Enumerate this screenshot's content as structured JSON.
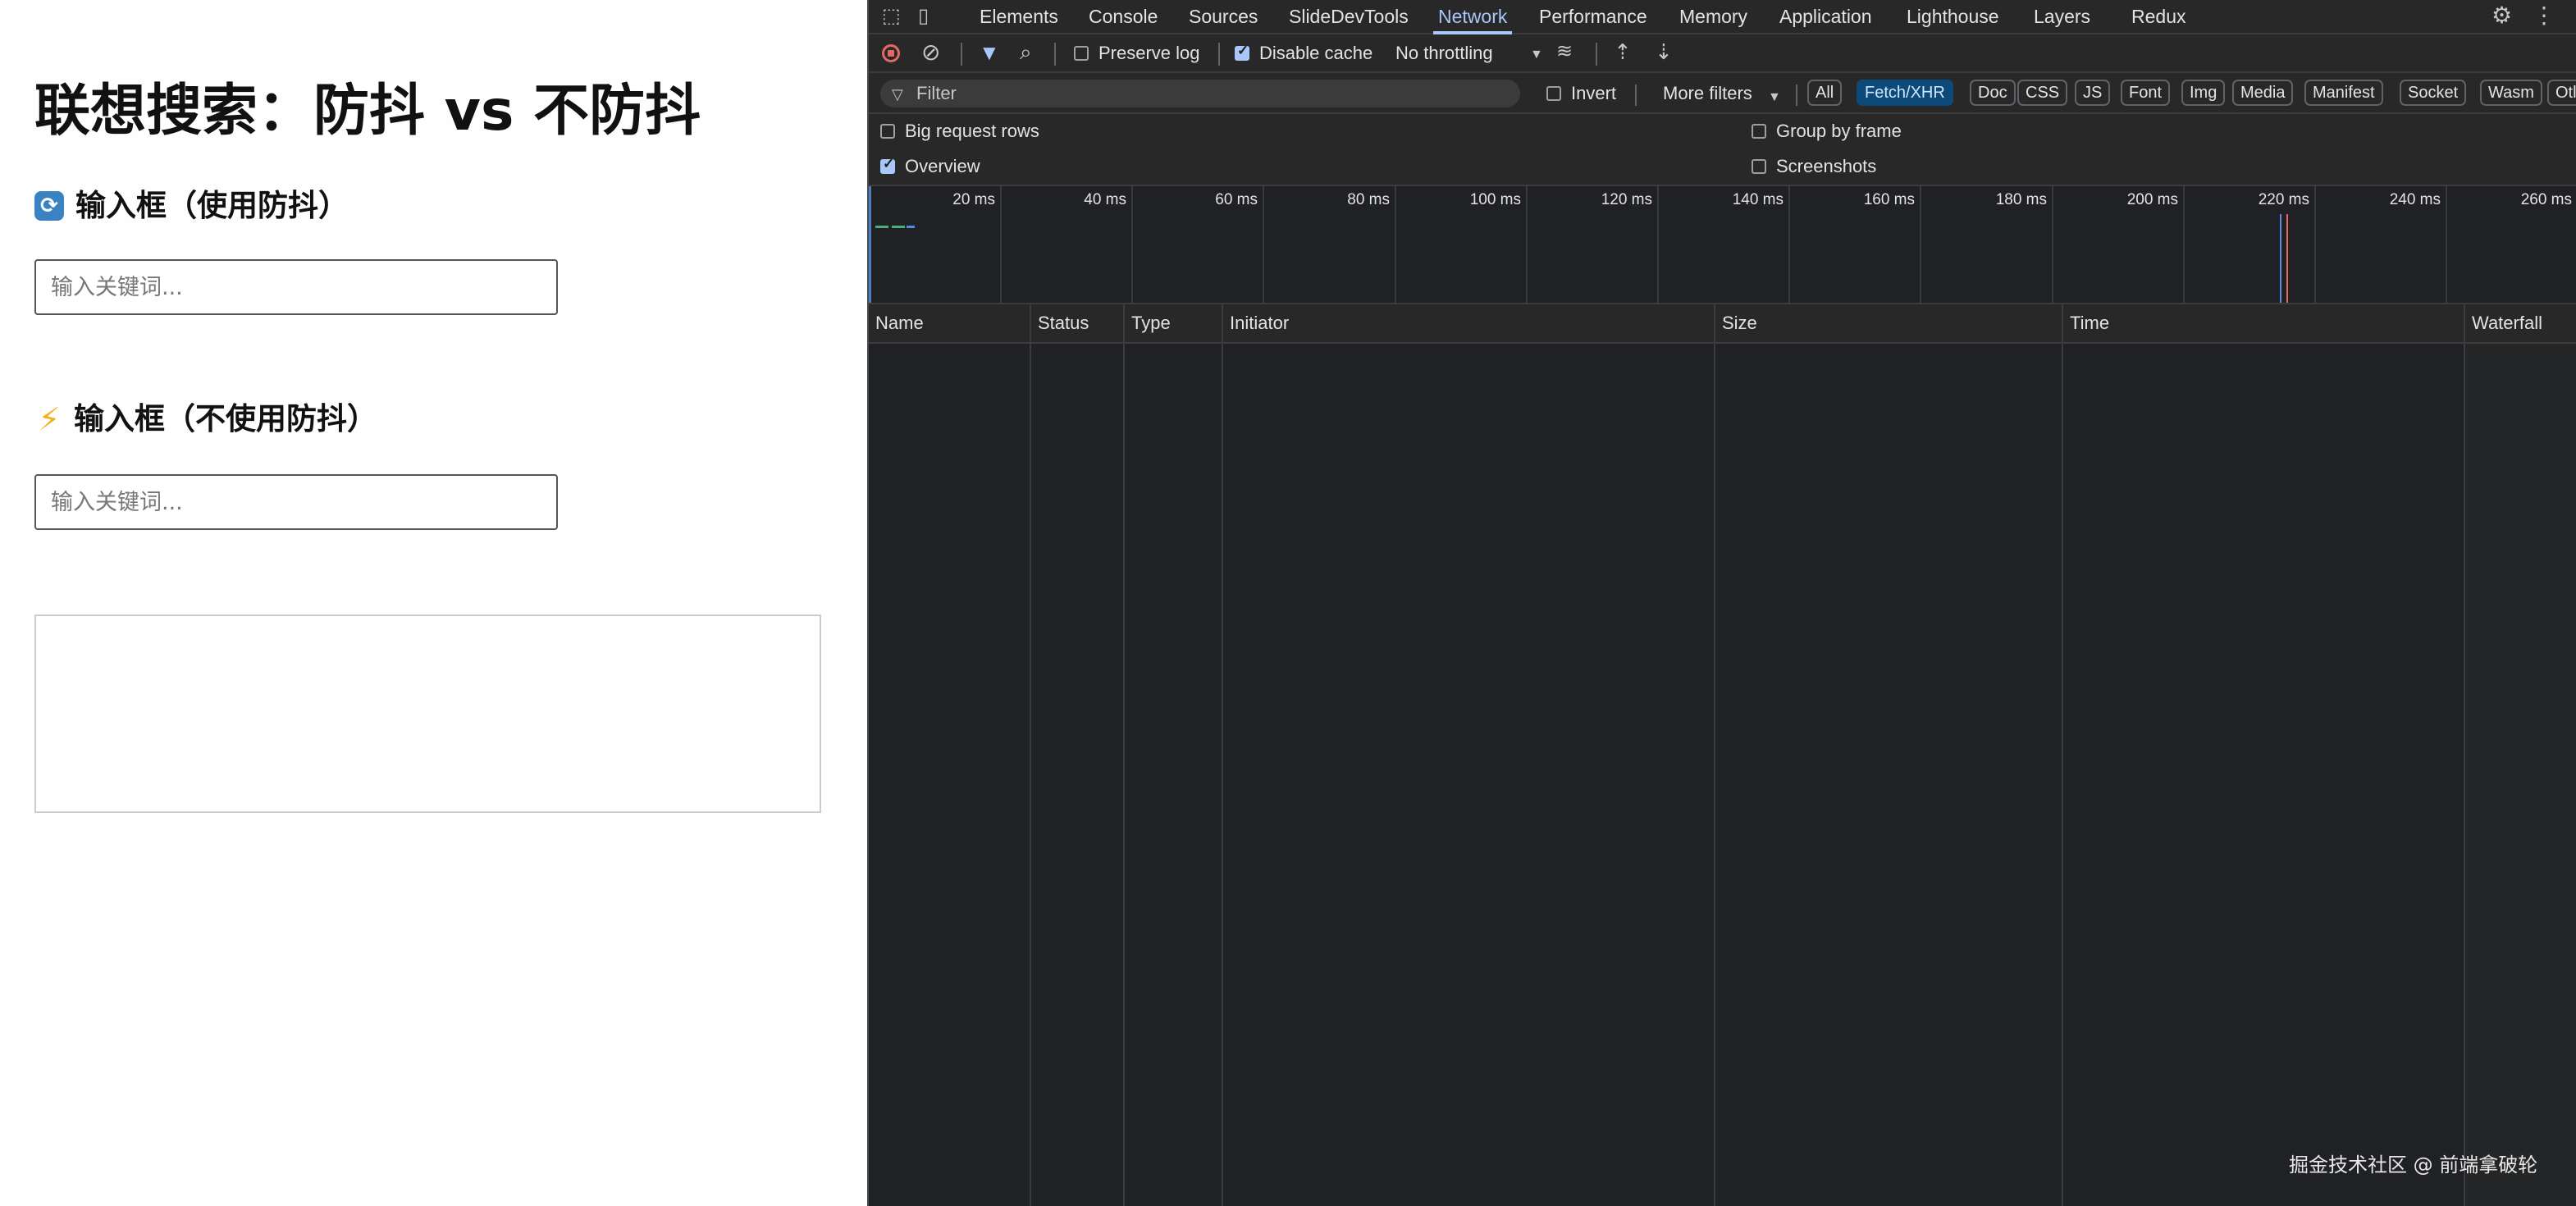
{
  "page": {
    "title": "联想搜索：防抖 vs 不防抖",
    "debounce_section": {
      "icon": "refresh-emoji",
      "heading": "输入框（使用防抖）",
      "placeholder": "输入关键词..."
    },
    "no_debounce_section": {
      "icon": "lightning-emoji",
      "heading": "输入框（不使用防抖）",
      "placeholder": "输入关键词..."
    }
  },
  "devtools": {
    "tabs": [
      {
        "label": "Elements"
      },
      {
        "label": "Console"
      },
      {
        "label": "Sources"
      },
      {
        "label": "SlideDevTools"
      },
      {
        "label": "Network"
      },
      {
        "label": "Performance"
      },
      {
        "label": "Memory"
      },
      {
        "label": "Application"
      },
      {
        "label": "Lighthouse"
      },
      {
        "label": "Layers"
      },
      {
        "label": "Redux"
      }
    ],
    "active_tab": "Network",
    "toolbar": {
      "preserve_log": {
        "label": "Preserve log",
        "checked": false
      },
      "disable_cache": {
        "label": "Disable cache",
        "checked": true
      },
      "throttling": "No throttling"
    },
    "filter": {
      "placeholder": "Filter",
      "invert": {
        "label": "Invert",
        "checked": false
      },
      "more_filters": "More filters",
      "types": [
        {
          "label": "All"
        },
        {
          "label": "Fetch/XHR"
        },
        {
          "label": "Doc"
        },
        {
          "label": "CSS"
        },
        {
          "label": "JS"
        },
        {
          "label": "Font"
        },
        {
          "label": "Img"
        },
        {
          "label": "Media"
        },
        {
          "label": "Manifest"
        },
        {
          "label": "Socket"
        },
        {
          "label": "Wasm"
        },
        {
          "label": "Otl"
        }
      ],
      "active_type": "Fetch/XHR"
    },
    "settings": {
      "big_request_rows": {
        "label": "Big request rows",
        "checked": false
      },
      "group_by_frame": {
        "label": "Group by frame",
        "checked": false
      },
      "overview": {
        "label": "Overview",
        "checked": true
      },
      "screenshots": {
        "label": "Screenshots",
        "checked": false
      }
    },
    "timeline_ticks": [
      "20 ms",
      "40 ms",
      "60 ms",
      "80 ms",
      "100 ms",
      "120 ms",
      "140 ms",
      "160 ms",
      "180 ms",
      "200 ms",
      "220 ms",
      "240 ms",
      "260 ms"
    ],
    "columns": [
      "Name",
      "Status",
      "Type",
      "Initiator",
      "Size",
      "Time",
      "Waterfall"
    ],
    "colors": {
      "accent": "#a8c7fa",
      "active_chip": "#0d4a7a",
      "record": "#e46962"
    }
  },
  "watermark": "掘金技术社区 @ 前端拿破轮"
}
